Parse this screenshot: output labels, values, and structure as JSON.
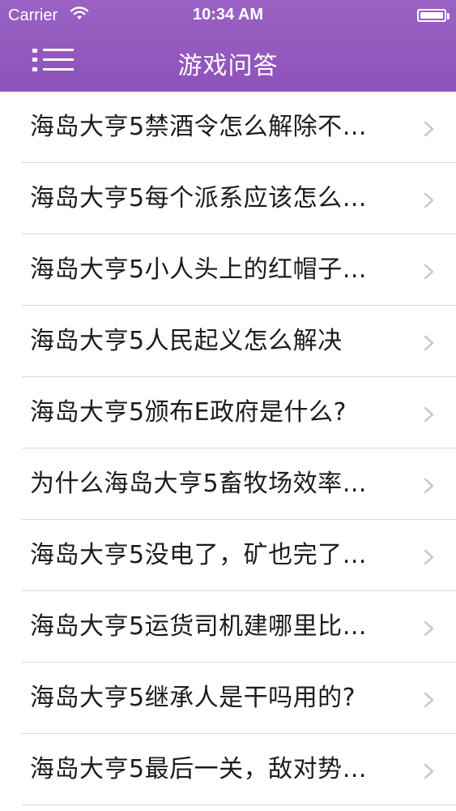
{
  "statusbar": {
    "carrier": "Carrier",
    "time": "10:34 AM"
  },
  "navbar": {
    "title": "游戏问答"
  },
  "colors": {
    "header_purple": "#9158bd",
    "separator": "#d8d8d8",
    "chevron": "#c7c7cc"
  },
  "list": {
    "items": [
      {
        "label": "海岛大亨5禁酒令怎么解除不…"
      },
      {
        "label": "海岛大亨5每个派系应该怎么…"
      },
      {
        "label": "海岛大亨5小人头上的红帽子…"
      },
      {
        "label": "海岛大亨5人民起义怎么解决"
      },
      {
        "label": "海岛大亨5颁布E政府是什么?"
      },
      {
        "label": "为什么海岛大亨5畜牧场效率…"
      },
      {
        "label": "海岛大亨5没电了，矿也完了…"
      },
      {
        "label": "海岛大亨5运货司机建哪里比…"
      },
      {
        "label": "海岛大亨5继承人是干吗用的?"
      },
      {
        "label": "海岛大亨5最后一关，敌对势…"
      }
    ]
  }
}
